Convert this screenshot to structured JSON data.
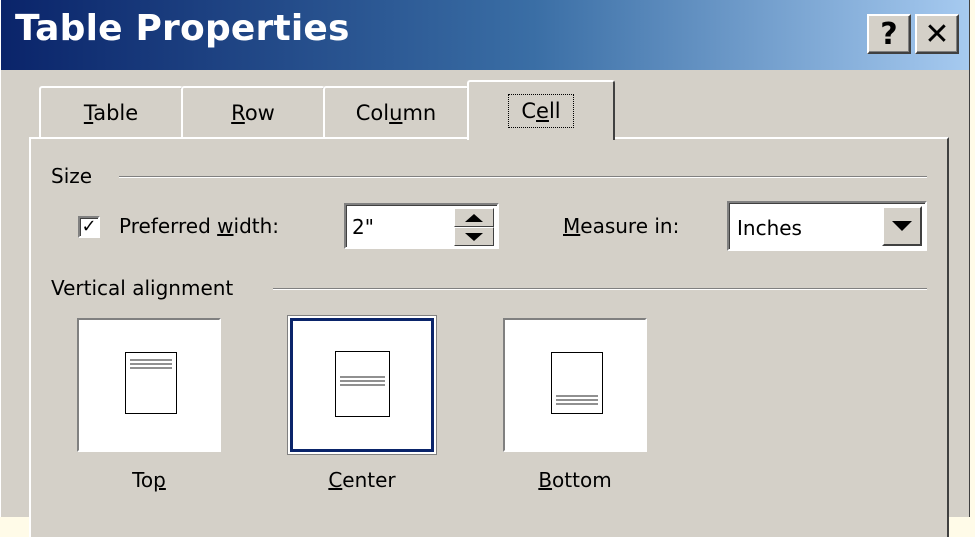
{
  "window": {
    "title": "Table Properties",
    "help_button": "?",
    "close_button": "✕"
  },
  "tabs": [
    {
      "label_pre": "",
      "label_u": "T",
      "label_post": "able"
    },
    {
      "label_pre": "",
      "label_u": "R",
      "label_post": "ow"
    },
    {
      "label_pre": "Col",
      "label_u": "u",
      "label_post": "mn"
    },
    {
      "label_pre": "C",
      "label_u": "e",
      "label_post": "ll",
      "selected": true
    }
  ],
  "size": {
    "group_label": "Size",
    "preferred_width": {
      "checked": true,
      "check_mark": "✓",
      "label_pre": "Preferred ",
      "label_u": "w",
      "label_post": "idth:",
      "value": "2\""
    },
    "measure_in": {
      "label_u": "M",
      "label_post": "easure in:",
      "value": "Inches"
    }
  },
  "vertical_alignment": {
    "group_label": "Vertical alignment",
    "options": [
      {
        "label_pre": "To",
        "label_u": "p",
        "label_post": ""
      },
      {
        "label_pre": "",
        "label_u": "C",
        "label_post": "enter",
        "selected": true
      },
      {
        "label_pre": "",
        "label_u": "B",
        "label_post": "ottom"
      }
    ]
  },
  "colors": {
    "title_gradient_start": "#0a246a",
    "title_gradient_end": "#a6caf0",
    "dialog_face": "#d4d0c8",
    "selection_border": "#0a246a"
  }
}
